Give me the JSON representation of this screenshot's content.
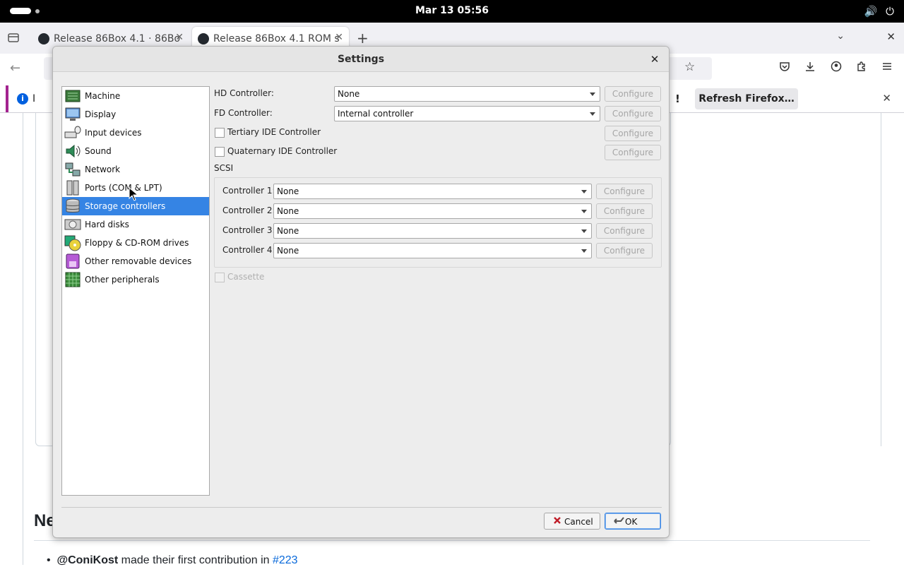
{
  "topbar": {
    "clock": "Mar 13  05:56",
    "volume_icon": "🔊",
    "power_icon": "⏻"
  },
  "browser": {
    "tabs": [
      {
        "title": "Release 86Box 4.1 · 86Bo"
      },
      {
        "title": "Release 86Box 4.1 ROM s"
      }
    ],
    "notification": {
      "prefix": "I",
      "bang": "!",
      "button": "Refresh Firefox…"
    }
  },
  "page": {
    "heading": "Ne",
    "contrib": {
      "user": "@ConiKost",
      "text": " made their first contribution in ",
      "pr": "#223"
    }
  },
  "dialog": {
    "title": "Settings",
    "categories": [
      {
        "label": "Machine",
        "icon": "machine-icon"
      },
      {
        "label": "Display",
        "icon": "display-icon"
      },
      {
        "label": "Input devices",
        "icon": "input-devices-icon"
      },
      {
        "label": "Sound",
        "icon": "sound-icon"
      },
      {
        "label": "Network",
        "icon": "network-icon"
      },
      {
        "label": "Ports (COM & LPT)",
        "icon": "ports-icon"
      },
      {
        "label": "Storage controllers",
        "icon": "storage-icon"
      },
      {
        "label": "Hard disks",
        "icon": "hard-disk-icon"
      },
      {
        "label": "Floppy & CD-ROM drives",
        "icon": "floppy-cdrom-icon"
      },
      {
        "label": "Other removable devices",
        "icon": "removable-icon"
      },
      {
        "label": "Other peripherals",
        "icon": "peripherals-icon"
      }
    ],
    "selected_category": "Storage controllers",
    "hd_controller": {
      "label": "HD Controller:",
      "value": "None"
    },
    "fd_controller": {
      "label": "FD Controller:",
      "value": "Internal controller"
    },
    "tertiary_ide": {
      "label": "Tertiary IDE Controller",
      "checked": false
    },
    "quaternary_ide": {
      "label": "Quaternary IDE Controller",
      "checked": false
    },
    "scsi": {
      "title": "SCSI",
      "controllers": [
        {
          "label": "Controller 1:",
          "value": "None"
        },
        {
          "label": "Controller 2:",
          "value": "None"
        },
        {
          "label": "Controller 3:",
          "value": "None"
        },
        {
          "label": "Controller 4:",
          "value": "None"
        }
      ]
    },
    "cassette": {
      "label": "Cassette",
      "checked": false,
      "enabled": false
    },
    "configure_label": "Configure",
    "cancel_label": "Cancel",
    "ok_label": "OK"
  },
  "colors": {
    "selection": "#3584e4",
    "link": "#0969da",
    "notification_accent": "#a3238f"
  }
}
